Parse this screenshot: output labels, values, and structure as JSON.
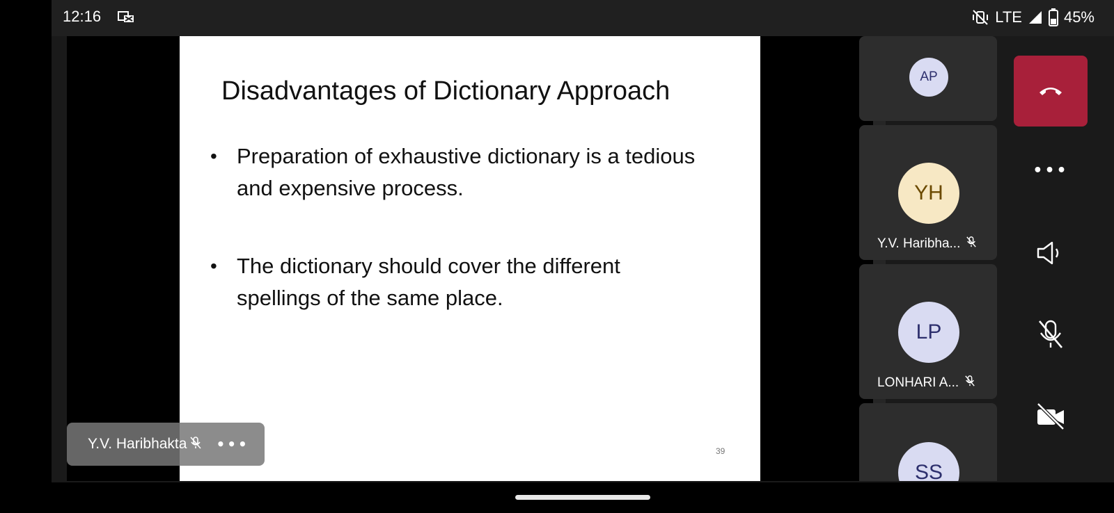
{
  "status_bar": {
    "time": "12:16",
    "network": "LTE",
    "battery": "45%",
    "icons": [
      "screen-cast-icon",
      "vibrate-off-icon",
      "signal-icon",
      "battery-icon"
    ]
  },
  "slide": {
    "title": "Disadvantages of Dictionary Approach",
    "bullets": [
      "Preparation of exhaustive dictionary is a tedious and expensive process.",
      "The dictionary should cover the different spellings of the same place."
    ],
    "page_number": "39"
  },
  "presenter": {
    "name": "Y.V. Haribhakta",
    "more": "•••"
  },
  "participants": [
    {
      "initials": "AP"
    },
    {
      "initials": "YH",
      "name": "Y.V. Haribha...",
      "avatar_color": "#f7e8c4"
    },
    {
      "initials": "LP",
      "name": "LONHARI A...",
      "avatar_color": "#d9dbf2"
    },
    {
      "initials": "SS"
    }
  ],
  "controls": {
    "more": "•••",
    "end_call_color": "#a8203a"
  }
}
